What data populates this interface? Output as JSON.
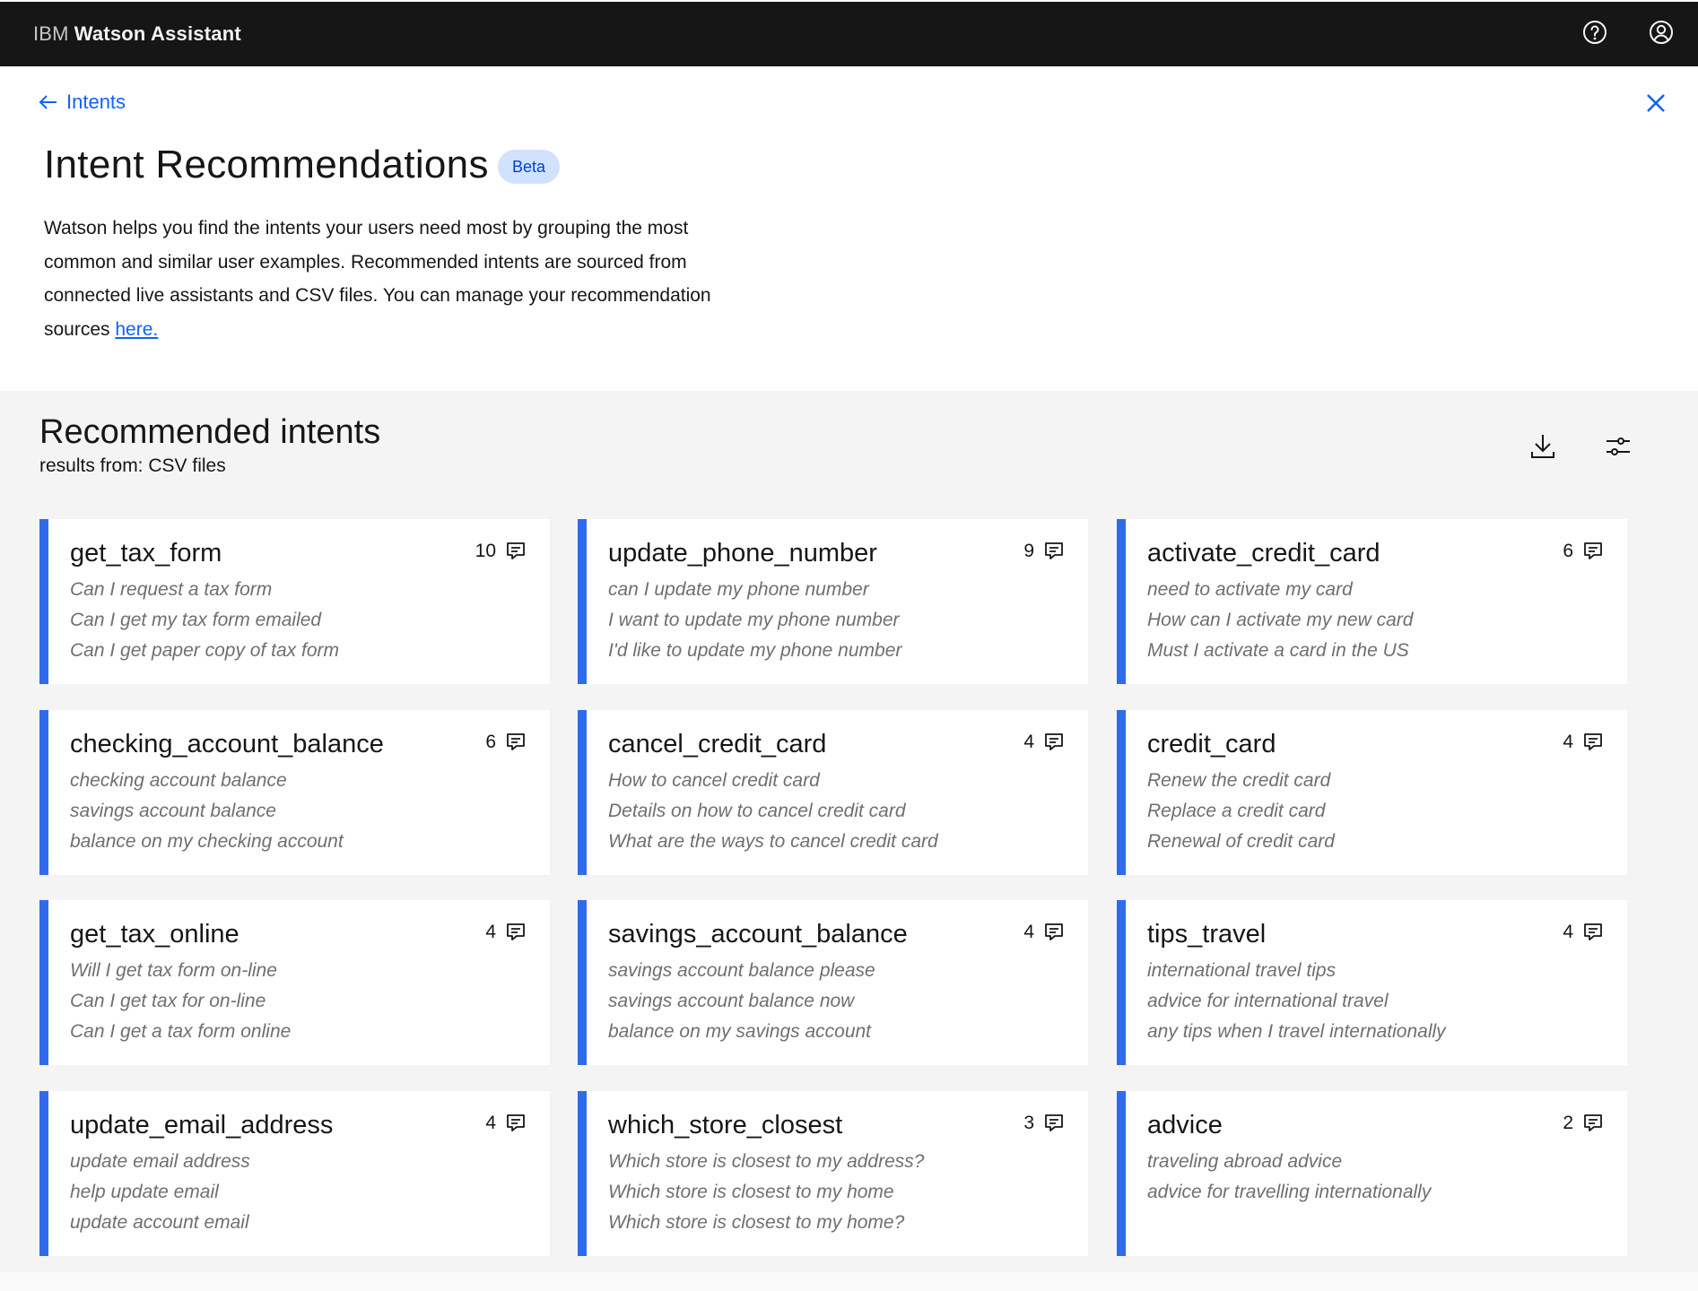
{
  "header": {
    "brand_prefix": "IBM",
    "brand_name": "Watson Assistant",
    "icons": [
      "help-icon",
      "user-avatar-icon"
    ]
  },
  "breadcrumb": {
    "back_label": "Intents"
  },
  "page": {
    "title": "Intent Recommendations",
    "badge": "Beta",
    "description": "Watson helps you find the intents your users need most by grouping the most common and similar user examples. Recommended intents are sourced from connected live assistants and CSV files. You can manage your recommendation sources ",
    "description_link": "here."
  },
  "section": {
    "title": "Recommended intents",
    "subtitle": "results from: CSV files",
    "actions": [
      "download-icon",
      "settings-adjust-icon"
    ]
  },
  "colors": {
    "accent": "#2f6bec",
    "link": "#0f62fe",
    "topbar": "#161616",
    "badge_bg": "#d0e2ff"
  },
  "intents": [
    {
      "name": "get_tax_form",
      "count": "10",
      "examples": [
        "Can I request a tax form",
        "Can I get my tax form emailed",
        "Can I get paper copy of tax form"
      ]
    },
    {
      "name": "update_phone_number",
      "count": "9",
      "examples": [
        "can I update my phone number",
        "I want to update my phone number",
        "I'd like to update my phone number"
      ]
    },
    {
      "name": "activate_credit_card",
      "count": "6",
      "examples": [
        "need to activate my card",
        "How can I activate my new card",
        "Must I activate a card in the US"
      ]
    },
    {
      "name": "checking_account_balance",
      "count": "6",
      "examples": [
        "checking account balance",
        "savings account balance",
        "balance on my checking account"
      ]
    },
    {
      "name": "cancel_credit_card",
      "count": "4",
      "examples": [
        "How to cancel credit card",
        "Details on how to cancel credit card",
        "What are the ways to cancel credit card"
      ]
    },
    {
      "name": "credit_card",
      "count": "4",
      "examples": [
        "Renew the credit card",
        "Replace a credit card",
        "Renewal of credit card"
      ]
    },
    {
      "name": "get_tax_online",
      "count": "4",
      "examples": [
        "Will I get tax form on-line",
        "Can I get tax for on-line",
        "Can I get a tax form online"
      ]
    },
    {
      "name": "savings_account_balance",
      "count": "4",
      "examples": [
        "savings account balance please",
        "savings account balance now",
        "balance on my savings account"
      ]
    },
    {
      "name": "tips_travel",
      "count": "4",
      "examples": [
        "international travel tips",
        "advice for international travel",
        "any tips when I travel internationally"
      ]
    },
    {
      "name": "update_email_address",
      "count": "4",
      "examples": [
        "update email address",
        "help update email",
        "update account email"
      ]
    },
    {
      "name": "which_store_closest",
      "count": "3",
      "examples": [
        "Which store is closest to my address?",
        "Which store is closest to my home",
        "Which store is closest to my home?"
      ]
    },
    {
      "name": "advice",
      "count": "2",
      "examples": [
        "traveling abroad advice",
        "advice for travelling internationally"
      ]
    }
  ]
}
